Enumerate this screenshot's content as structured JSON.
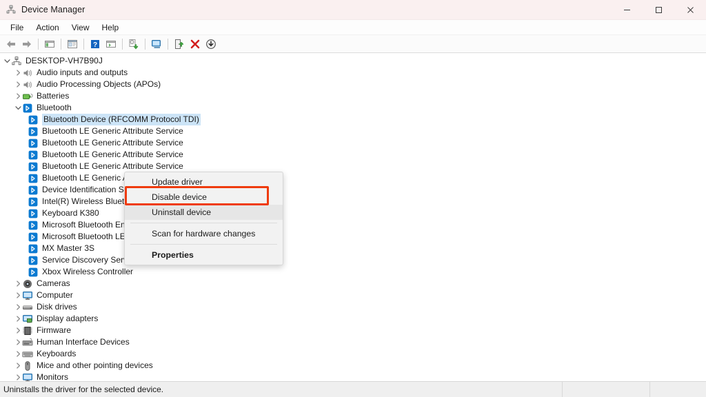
{
  "window": {
    "title": "Device Manager",
    "icon": "device-manager-icon",
    "controls": {
      "minimize": "—",
      "maximize": "☐",
      "close": "✕"
    }
  },
  "menubar": {
    "items": [
      "File",
      "Action",
      "View",
      "Help"
    ]
  },
  "toolbar": {
    "items": [
      {
        "name": "back-icon",
        "title": "Back"
      },
      {
        "name": "forward-icon",
        "title": "Forward"
      },
      {
        "sep": true
      },
      {
        "name": "show-hide-console-tree-icon",
        "title": "Show/Hide Console Tree"
      },
      {
        "sep": true
      },
      {
        "name": "properties-icon",
        "title": "Properties"
      },
      {
        "sep": true
      },
      {
        "name": "help-icon",
        "title": "Help"
      },
      {
        "name": "view-icon",
        "title": "View"
      },
      {
        "sep": true
      },
      {
        "name": "update-driver-icon",
        "title": "Update driver"
      },
      {
        "sep": true
      },
      {
        "name": "scan-hardware-changes-icon",
        "title": "Scan for hardware changes"
      },
      {
        "sep": true
      },
      {
        "name": "enable-device-icon",
        "title": "Enable device"
      },
      {
        "name": "uninstall-device-icon",
        "title": "Uninstall device"
      },
      {
        "name": "disable-device-icon",
        "title": "Disable device"
      }
    ]
  },
  "tree": {
    "nodes": [
      {
        "label": "DESKTOP-VH7B90J",
        "depth": 0,
        "state": "expanded",
        "icon": "computer-root-icon"
      },
      {
        "label": "Audio inputs and outputs",
        "depth": 1,
        "state": "collapsed",
        "icon": "speaker-icon"
      },
      {
        "label": "Audio Processing Objects (APOs)",
        "depth": 1,
        "state": "collapsed",
        "icon": "speaker-icon"
      },
      {
        "label": "Batteries",
        "depth": 1,
        "state": "collapsed",
        "icon": "battery-icon"
      },
      {
        "label": "Bluetooth",
        "depth": 1,
        "state": "expanded",
        "icon": "bluetooth-icon"
      },
      {
        "label": "Bluetooth Device (RFCOMM Protocol TDI)",
        "depth": 2,
        "state": "leaf",
        "icon": "bluetooth-icon",
        "selected": true
      },
      {
        "label": "Bluetooth LE Generic Attribute Service",
        "depth": 2,
        "state": "leaf",
        "icon": "bluetooth-icon"
      },
      {
        "label": "Bluetooth LE Generic Attribute Service",
        "depth": 2,
        "state": "leaf",
        "icon": "bluetooth-icon"
      },
      {
        "label": "Bluetooth LE Generic Attribute Service",
        "depth": 2,
        "state": "leaf",
        "icon": "bluetooth-icon"
      },
      {
        "label": "Bluetooth LE Generic Attribute Service",
        "depth": 2,
        "state": "leaf",
        "icon": "bluetooth-icon"
      },
      {
        "label": "Bluetooth LE Generic Attribute Service",
        "depth": 2,
        "state": "leaf",
        "icon": "bluetooth-icon"
      },
      {
        "label": "Device Identification Service",
        "depth": 2,
        "state": "leaf",
        "icon": "bluetooth-icon"
      },
      {
        "label": "Intel(R) Wireless Bluetooth(R)",
        "depth": 2,
        "state": "leaf",
        "icon": "bluetooth-icon"
      },
      {
        "label": "Keyboard K380",
        "depth": 2,
        "state": "leaf",
        "icon": "bluetooth-icon"
      },
      {
        "label": "Microsoft Bluetooth Enumerator",
        "depth": 2,
        "state": "leaf",
        "icon": "bluetooth-icon"
      },
      {
        "label": "Microsoft Bluetooth LE Enumerator",
        "depth": 2,
        "state": "leaf",
        "icon": "bluetooth-icon"
      },
      {
        "label": "MX Master 3S",
        "depth": 2,
        "state": "leaf",
        "icon": "bluetooth-icon"
      },
      {
        "label": "Service Discovery Service",
        "depth": 2,
        "state": "leaf",
        "icon": "bluetooth-icon"
      },
      {
        "label": "Xbox Wireless Controller",
        "depth": 2,
        "state": "leaf",
        "icon": "bluetooth-icon"
      },
      {
        "label": "Cameras",
        "depth": 1,
        "state": "collapsed",
        "icon": "camera-icon"
      },
      {
        "label": "Computer",
        "depth": 1,
        "state": "collapsed",
        "icon": "monitor-icon"
      },
      {
        "label": "Disk drives",
        "depth": 1,
        "state": "collapsed",
        "icon": "disk-drive-icon"
      },
      {
        "label": "Display adapters",
        "depth": 1,
        "state": "collapsed",
        "icon": "display-adapter-icon"
      },
      {
        "label": "Firmware",
        "depth": 1,
        "state": "collapsed",
        "icon": "firmware-chip-icon"
      },
      {
        "label": "Human Interface Devices",
        "depth": 1,
        "state": "collapsed",
        "icon": "hid-icon"
      },
      {
        "label": "Keyboards",
        "depth": 1,
        "state": "collapsed",
        "icon": "keyboard-icon"
      },
      {
        "label": "Mice and other pointing devices",
        "depth": 1,
        "state": "collapsed",
        "icon": "mouse-icon"
      },
      {
        "label": "Monitors",
        "depth": 1,
        "state": "collapsed",
        "icon": "monitor-icon"
      }
    ]
  },
  "context_menu": {
    "items": [
      {
        "label": "Update driver",
        "hover": false,
        "bold": false
      },
      {
        "label": "Disable device",
        "hover": false,
        "bold": false,
        "annotated": true
      },
      {
        "label": "Uninstall device",
        "hover": true,
        "bold": false
      },
      {
        "separator": true
      },
      {
        "label": "Scan for hardware changes",
        "hover": false,
        "bold": false
      },
      {
        "separator": true
      },
      {
        "label": "Properties",
        "hover": false,
        "bold": true
      }
    ]
  },
  "annotation": {
    "color": "#ef3b0c",
    "target": "Disable device"
  },
  "statusbar": {
    "message": "Uninstalls the driver for the selected device."
  },
  "colors": {
    "titlebar": "#faf0f0",
    "selection": "#cce4f7",
    "bluetooth": "#0b7ad1",
    "annotation": "#ef3b0c",
    "menu_bg": "#f2f2f2"
  }
}
